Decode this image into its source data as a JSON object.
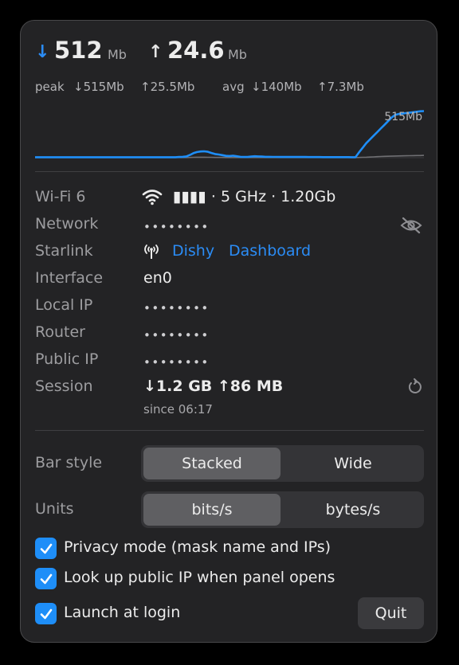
{
  "header": {
    "down_arrow": "↓",
    "down_value": "512",
    "down_unit": "Mb",
    "up_arrow": "↑",
    "up_value": "24.6",
    "up_unit": "Mb"
  },
  "stats": {
    "peak_label": "peak",
    "peak_down": "↓515Mb",
    "peak_up": "↑25.5Mb",
    "avg_label": "avg",
    "avg_down": "↓140Mb",
    "avg_up": "↑7.3Mb"
  },
  "chart_data": {
    "type": "line",
    "annotation": "515Mb",
    "ylim": [
      0,
      560
    ],
    "series": [
      {
        "color": "#1e8ef8",
        "values": [
          5,
          5,
          5,
          5,
          5,
          5,
          5,
          5,
          5,
          5,
          5,
          5,
          5,
          5,
          5,
          5,
          5,
          5,
          5,
          5,
          5,
          5,
          5,
          5,
          5,
          5,
          5,
          5,
          5,
          5,
          5,
          5,
          5,
          5,
          5,
          5,
          5,
          5,
          5,
          5,
          8,
          10,
          14,
          30,
          50,
          62,
          68,
          70,
          65,
          52,
          40,
          35,
          28,
          20,
          18,
          22,
          16,
          10,
          8,
          8,
          12,
          16,
          14,
          12,
          10,
          10,
          9,
          9,
          8,
          8,
          8,
          8,
          8,
          8,
          8,
          8,
          7,
          7,
          7,
          7,
          6,
          6,
          6,
          6,
          6,
          6,
          6,
          6,
          5,
          5,
          60,
          110,
          160,
          200,
          240,
          280,
          320,
          360,
          400,
          440,
          470,
          480,
          485,
          490,
          495,
          500,
          505,
          510,
          512
        ]
      },
      {
        "color": "#6f6f73",
        "values": [
          2,
          2,
          2,
          2,
          2,
          2,
          2,
          2,
          2,
          2,
          2,
          2,
          2,
          2,
          2,
          2,
          2,
          2,
          2,
          2,
          2,
          2,
          2,
          2,
          2,
          2,
          2,
          2,
          2,
          2,
          2,
          2,
          2,
          2,
          2,
          2,
          2,
          2,
          2,
          2,
          2,
          2,
          2,
          3,
          4,
          5,
          5,
          5,
          4,
          4,
          3,
          3,
          3,
          2,
          2,
          2,
          2,
          2,
          2,
          2,
          2,
          2,
          2,
          2,
          2,
          2,
          2,
          2,
          2,
          2,
          2,
          2,
          2,
          2,
          2,
          2,
          2,
          2,
          2,
          2,
          2,
          2,
          2,
          2,
          2,
          2,
          2,
          2,
          2,
          2,
          3,
          4,
          5,
          7,
          9,
          11,
          13,
          15,
          16,
          17,
          18,
          19,
          20,
          21,
          22,
          23,
          24,
          24,
          25
        ]
      }
    ]
  },
  "info": {
    "wifi_label": "Wi-Fi 6",
    "wifi_value": "▮▮▮▮ · 5 GHz · 1.20Gb",
    "network_label": "Network",
    "network_value": "••••••••",
    "starlink_label": "Starlink",
    "starlink_link1": "Dishy",
    "starlink_link2": "Dashboard",
    "interface_label": "Interface",
    "interface_value": "en0",
    "localip_label": "Local IP",
    "localip_value": "••••••••",
    "router_label": "Router",
    "router_value": "••••••••",
    "publicip_label": "Public IP",
    "publicip_value": "••••••••",
    "session_label": "Session",
    "session_value": "↓1.2 GB ↑86 MB",
    "session_since": "since 06:17"
  },
  "bar_style": {
    "label": "Bar style",
    "options": [
      "Stacked",
      "Wide"
    ],
    "selected": "Stacked"
  },
  "units": {
    "label": "Units",
    "options": [
      "bits/s",
      "bytes/s"
    ],
    "selected": "bits/s"
  },
  "checkboxes": {
    "privacy": "Privacy mode (mask name and IPs)",
    "lookup": "Look up public IP when panel opens",
    "launch": "Launch at login"
  },
  "quit_label": "Quit",
  "colors": {
    "accent": "#1e8ef8",
    "panel_bg": "#232325"
  }
}
